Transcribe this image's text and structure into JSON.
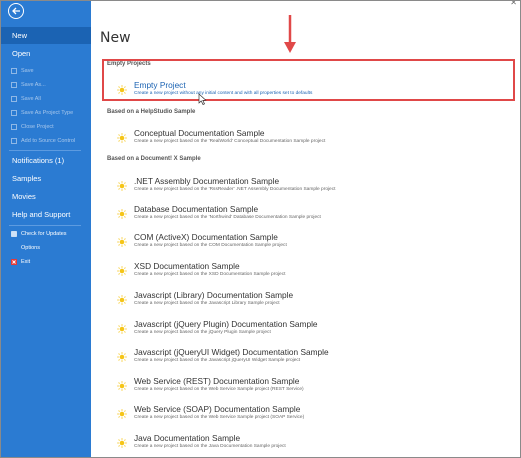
{
  "sidebar": {
    "items": [
      {
        "label": "New"
      },
      {
        "label": "Open"
      },
      {
        "label": "Save"
      },
      {
        "label": "Save As..."
      },
      {
        "label": "Save All"
      },
      {
        "label": "Save As Project Type"
      },
      {
        "label": "Close Project"
      },
      {
        "label": "Add to Source Control"
      },
      {
        "label": "Notifications (1)"
      },
      {
        "label": "Samples"
      },
      {
        "label": "Movies"
      },
      {
        "label": "Help and Support"
      },
      {
        "label": "Check for Updates"
      },
      {
        "label": "Options"
      },
      {
        "label": "Exit"
      }
    ]
  },
  "main": {
    "title": "New",
    "sections": [
      {
        "header": "Empty Projects",
        "items": [
          {
            "title": "Empty Project",
            "desc": "Create a new project without any initial content and with all properties set to defaults"
          }
        ]
      },
      {
        "header": "Based on a HelpStudio Sample",
        "items": [
          {
            "title": "Conceptual Documentation Sample",
            "desc": "Create a new project based on the 'RealWorld' Conceptual Documentation Sample project"
          }
        ]
      },
      {
        "header": "Based on a Document! X Sample",
        "items": [
          {
            "title": ".NET Assembly Documentation Sample",
            "desc": "Create a new project based on the 'RssReader' .NET Assembly Documentation Sample project"
          },
          {
            "title": "Database Documentation Sample",
            "desc": "Create a new project based on the 'Northwind' Database Documentation Sample project"
          },
          {
            "title": "COM (ActiveX) Documentation Sample",
            "desc": "Create a new project based on the COM Documentation Sample project"
          },
          {
            "title": "XSD Documentation Sample",
            "desc": "Create a new project based on the XSD Documentation Sample project"
          },
          {
            "title": "Javascript (Library) Documentation Sample",
            "desc": "Create a new project based on the Javascript Library Sample project"
          },
          {
            "title": "Javascript (jQuery Plugin) Documentation Sample",
            "desc": "Create a new project based on the jQuery Plugin Sample project"
          },
          {
            "title": "Javascript (jQueryUI Widget) Documentation Sample",
            "desc": "Create a new project based on the Javascript jQueryUI Widget Sample project"
          },
          {
            "title": "Web Service (REST) Documentation Sample",
            "desc": "Create a new project based on the Web Service Sample project (REST Service)"
          },
          {
            "title": "Web Service (SOAP) Documentation Sample",
            "desc": "Create a new project based on the Web Service Sample project (SOAP Service)"
          },
          {
            "title": "Java Documentation Sample",
            "desc": "Create a new project based on the Java Documentation Sample project"
          }
        ]
      }
    ]
  },
  "colors": {
    "sidebar": "#2b7bd2",
    "sidebar_active": "#1b63b3",
    "highlight": "#e04848",
    "icon": "#f5c518"
  },
  "icons": {
    "back": "back-arrow-icon",
    "item": "sun-icon",
    "save": "save-icon",
    "exit": "close-icon"
  }
}
